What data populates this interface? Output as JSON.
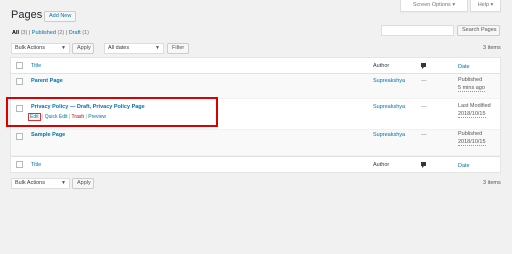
{
  "header": {
    "title": "Pages",
    "add_new": "Add New",
    "screen_options": "Screen Options ▾",
    "help": "Help ▾"
  },
  "views": {
    "all": "All",
    "all_count": "(3)",
    "sep1": "|",
    "published": "Published",
    "published_count": "(2)",
    "sep2": "|",
    "draft": "Draft",
    "draft_count": "(1)"
  },
  "search": {
    "button": "Search Pages",
    "value": ""
  },
  "tablenav_top": {
    "bulk_actions": "Bulk Actions",
    "apply": "Apply",
    "dates": "All dates",
    "filter": "Filter",
    "items": "3 items"
  },
  "tablenav_bottom": {
    "bulk_actions": "Bulk Actions",
    "apply": "Apply",
    "items": "3 items"
  },
  "columns": {
    "title": "Title",
    "author": "Author",
    "date": "Date"
  },
  "rows": [
    {
      "title": "Parent Page",
      "author": "Supreakshya",
      "comments": "—",
      "date_status": "Published",
      "date_value": "5 mins ago"
    },
    {
      "title": "Privacy Policy — Draft, Privacy Policy Page",
      "author": "Supreakshya",
      "comments": "—",
      "date_status": "Last Modified",
      "date_value": "2018/10/15",
      "actions": {
        "edit": "Edit",
        "quick_edit": "Quick Edit",
        "trash": "Trash",
        "preview": "Preview",
        "sep": "|"
      }
    },
    {
      "title": "Sample Page",
      "author": "Supreakshya",
      "comments": "—",
      "date_status": "Published",
      "date_value": "2018/10/15"
    }
  ],
  "colors": {
    "link": "#0073aa",
    "highlight": "#dd0000",
    "background": "#f1f1f1"
  },
  "icons": {
    "comment_column": "comment-bubble-icon"
  }
}
